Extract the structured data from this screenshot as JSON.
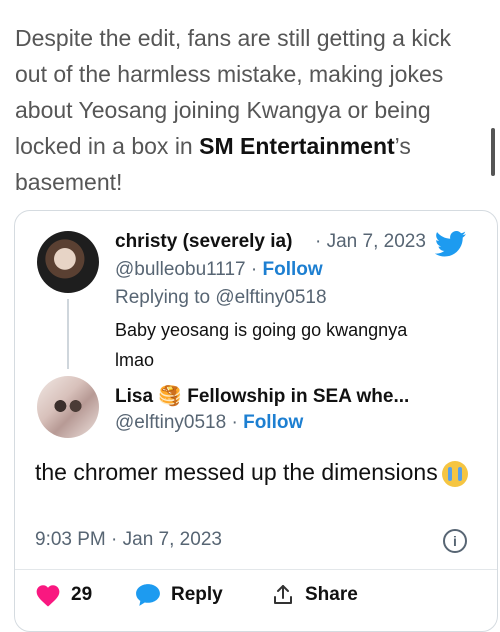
{
  "article": {
    "text_before": "Despite the edit, fans are still getting a kick out of the harmless mistake, making jokes about Yeosang joining Kwangya or being locked in a box in ",
    "bold": "SM Entertainment",
    "text_after": "’s basement!"
  },
  "tweet": {
    "parent": {
      "display_name": "christy (severely ia)",
      "date": "· Jan 7, 2023",
      "handle": "@bulleobu1117",
      "separator": "·",
      "follow_label": "Follow",
      "replying_to": "Replying to @elftiny0518",
      "text": "Baby yeosang is going go kwangnya lmao"
    },
    "reply": {
      "display_name": "Lisa 🥞 Fellowship in SEA whe...",
      "handle": "@elftiny0518",
      "separator": "·",
      "follow_label": "Follow",
      "text": "the chromer messed up the dimensions",
      "timestamp": "9:03 PM · Jan 7, 2023"
    },
    "actions": {
      "likes_count": "29",
      "reply_label": "Reply",
      "share_label": "Share"
    },
    "colors": {
      "twitter_blue": "#1d9bf0",
      "like_red": "#f91880",
      "follow_blue": "#1d7fd1"
    },
    "icons": [
      "twitter-bird-icon",
      "info-icon",
      "heart-icon",
      "reply-bubble-icon",
      "share-icon",
      "crying-face-emoji-icon"
    ]
  }
}
